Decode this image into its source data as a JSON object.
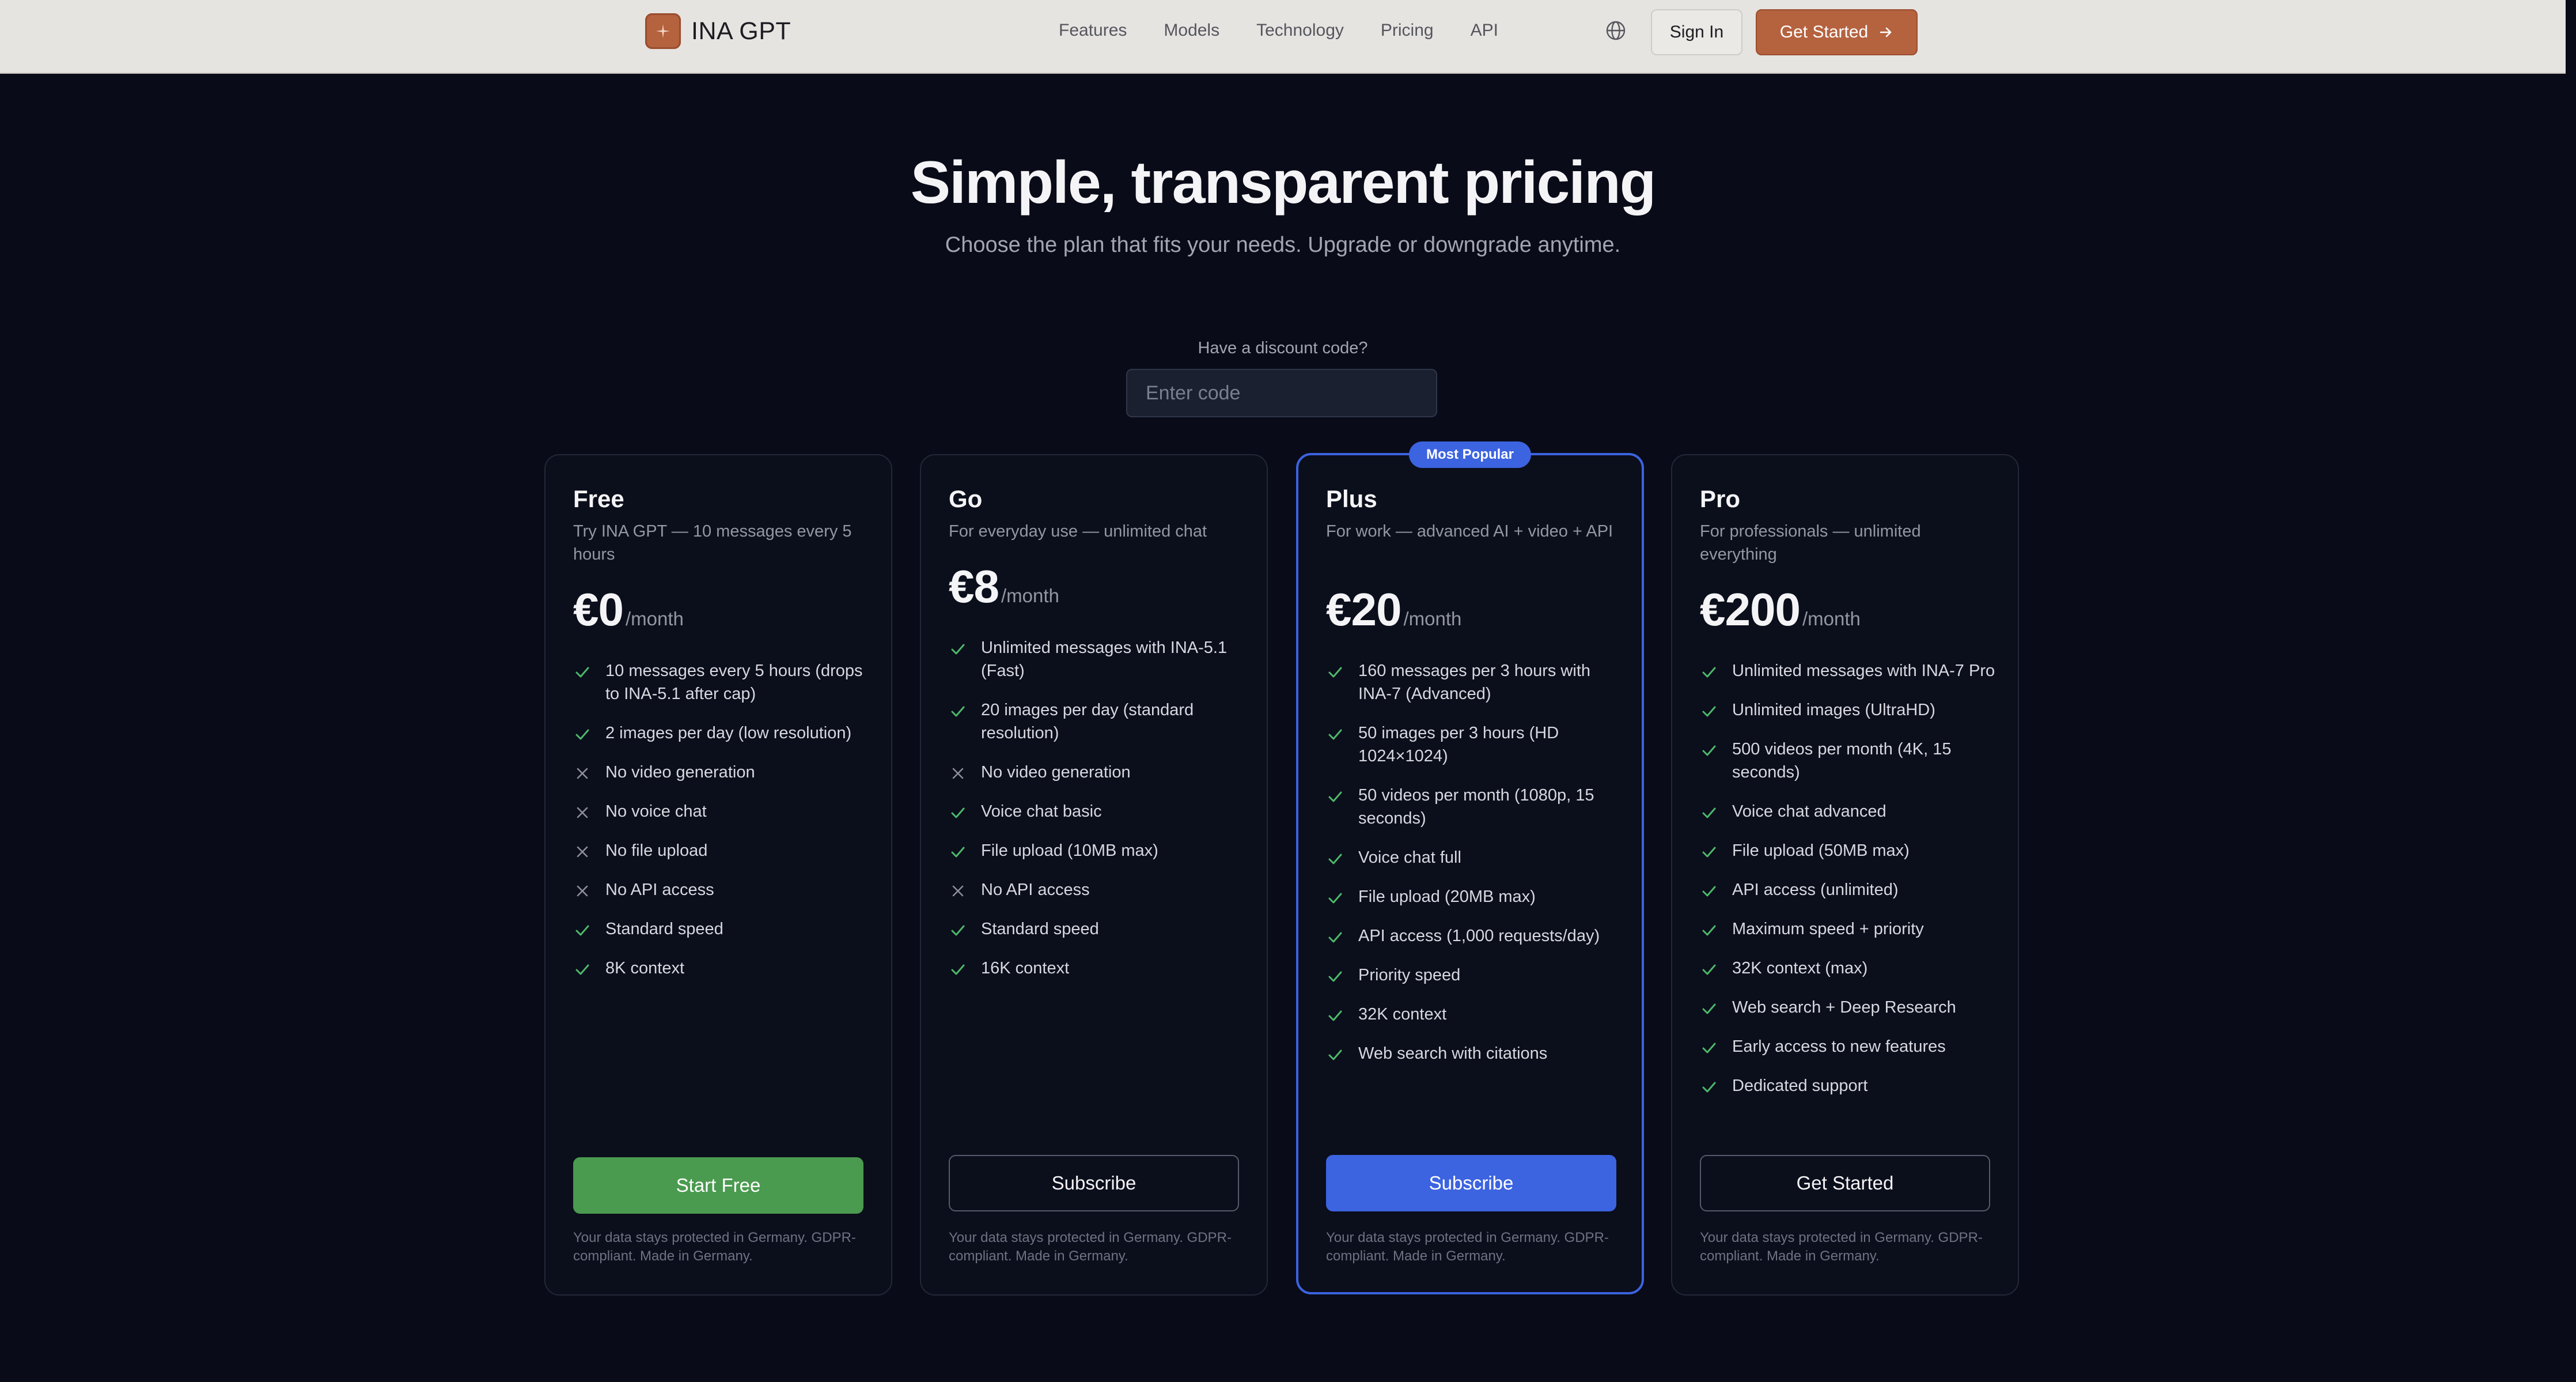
{
  "header": {
    "logo_text": "INA GPT",
    "nav": [
      "Features",
      "Models",
      "Technology",
      "Pricing",
      "API"
    ],
    "signin_label": "Sign In",
    "cta_label": "Get Started"
  },
  "hero": {
    "title": "Simple, transparent pricing",
    "subtitle": "Choose the plan that fits your needs. Upgrade or downgrade anytime."
  },
  "discount": {
    "label": "Have a discount code?",
    "placeholder": "Enter code",
    "value": ""
  },
  "colors": {
    "accent_blue": "#3c63e0",
    "accent_green": "#4a9a4f",
    "brand_orange": "#b5623f",
    "check": "#4cb96a",
    "cross": "#8b8e99"
  },
  "plans": [
    {
      "name": "Free",
      "desc": "Try INA GPT — 10 messages every 5 hours",
      "price": "€0",
      "period": "/month",
      "features": [
        {
          "text": "10 messages every 5 hours (drops to INA-5.1 after cap)",
          "included": true
        },
        {
          "text": "2 images per day (low resolution)",
          "included": true
        },
        {
          "text": "No video generation",
          "included": false
        },
        {
          "text": "No voice chat",
          "included": false
        },
        {
          "text": "No file upload",
          "included": false
        },
        {
          "text": "No API access",
          "included": false
        },
        {
          "text": "Standard speed",
          "included": true
        },
        {
          "text": "8K context",
          "included": true
        }
      ],
      "cta": "Start Free",
      "footer": "Your data stays protected in Germany. GDPR-compliant. Made in Germany."
    },
    {
      "name": "Go",
      "desc": "For everyday use — unlimited chat",
      "price": "€8",
      "period": "/month",
      "features": [
        {
          "text": "Unlimited messages with INA-5.1 (Fast)",
          "included": true
        },
        {
          "text": "20 images per day (standard resolution)",
          "included": true
        },
        {
          "text": "No video generation",
          "included": false
        },
        {
          "text": "Voice chat basic",
          "included": true
        },
        {
          "text": "File upload (10MB max)",
          "included": true
        },
        {
          "text": "No API access",
          "included": false
        },
        {
          "text": "Standard speed",
          "included": true
        },
        {
          "text": "16K context",
          "included": true
        }
      ],
      "cta": "Subscribe",
      "footer": "Your data stays protected in Germany. GDPR-compliant. Made in Germany."
    },
    {
      "name": "Plus",
      "badge": "Most Popular",
      "desc": "For work — advanced AI + video + API",
      "price": "€20",
      "period": "/month",
      "features": [
        {
          "text": "160 messages per 3 hours with INA-7 (Advanced)",
          "included": true
        },
        {
          "text": "50 images per 3 hours (HD 1024×1024)",
          "included": true
        },
        {
          "text": "50 videos per month (1080p, 15 seconds)",
          "included": true
        },
        {
          "text": "Voice chat full",
          "included": true
        },
        {
          "text": "File upload (20MB max)",
          "included": true
        },
        {
          "text": "API access (1,000 requests/day)",
          "included": true
        },
        {
          "text": "Priority speed",
          "included": true
        },
        {
          "text": "32K context",
          "included": true
        },
        {
          "text": "Web search with citations",
          "included": true
        }
      ],
      "cta": "Subscribe",
      "footer": "Your data stays protected in Germany. GDPR-compliant. Made in Germany."
    },
    {
      "name": "Pro",
      "desc": "For professionals — unlimited everything",
      "price": "€200",
      "period": "/month",
      "features": [
        {
          "text": "Unlimited messages with INA-7 Pro",
          "included": true
        },
        {
          "text": "Unlimited images (UltraHD)",
          "included": true
        },
        {
          "text": "500 videos per month (4K, 15 seconds)",
          "included": true
        },
        {
          "text": "Voice chat advanced",
          "included": true
        },
        {
          "text": "File upload (50MB max)",
          "included": true
        },
        {
          "text": "API access (unlimited)",
          "included": true
        },
        {
          "text": "Maximum speed + priority",
          "included": true
        },
        {
          "text": "32K context (max)",
          "included": true
        },
        {
          "text": "Web search + Deep Research",
          "included": true
        },
        {
          "text": "Early access to new features",
          "included": true
        },
        {
          "text": "Dedicated support",
          "included": true
        }
      ],
      "cta": "Get Started",
      "footer": "Your data stays protected in Germany. GDPR-compliant. Made in Germany."
    }
  ]
}
